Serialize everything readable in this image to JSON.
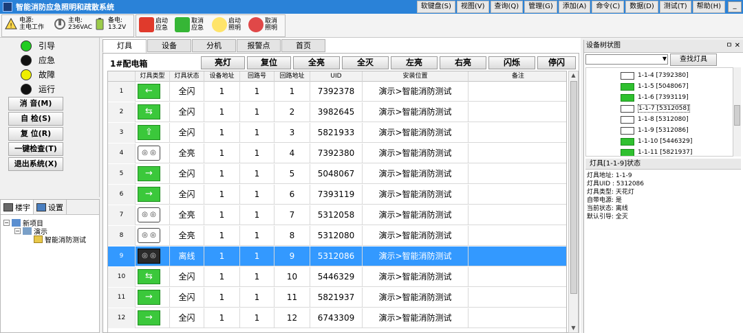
{
  "window": {
    "title": "智能消防应急照明和疏散系统",
    "min_label": "_"
  },
  "menu": [
    "软键盘(S)",
    "视图(V)",
    "查询(Q)",
    "管理(G)",
    "添加(A)",
    "命令(C)",
    "数据(D)",
    "测试(T)",
    "帮助(H)"
  ],
  "status": {
    "power": {
      "l1": "电源:",
      "l2": "主电工作"
    },
    "main_power": {
      "l1": "主电:",
      "l2": "236VAC"
    },
    "backup_power": {
      "l1": "备电:",
      "l2": "13.2V"
    }
  },
  "toolbar": {
    "start_emergency": {
      "l1": "启动",
      "l2": "应急"
    },
    "cancel_emergency": {
      "l1": "取消",
      "l2": "应急"
    },
    "start_lighting": {
      "l1": "启动",
      "l2": "照明"
    },
    "cancel_lighting": {
      "l1": "取消",
      "l2": "照明"
    }
  },
  "indicators": [
    {
      "label": "引导",
      "color": "#22cc22"
    },
    {
      "label": "应急",
      "color": "#111111"
    },
    {
      "label": "故障",
      "color": "#eeee00"
    },
    {
      "label": "运行",
      "color": "#111111"
    }
  ],
  "left_buttons": [
    "消  音(M)",
    "自  检(S)",
    "复  位(R)",
    "一键检查(T)",
    "退出系统(X)"
  ],
  "left_tabs": {
    "tree": "楼宇",
    "settings": "设置"
  },
  "project_tree": {
    "root": "新项目",
    "child": "演示",
    "leaf": "智能消防测试"
  },
  "tabs": [
    "灯具",
    "设备",
    "分机",
    "报警点",
    "首页"
  ],
  "cabinet": "1#配电箱",
  "commands": [
    "亮灯",
    "复位",
    "全亮",
    "全灭",
    "左亮",
    "右亮",
    "闪烁",
    "停闪"
  ],
  "grid": {
    "headers": [
      "灯具类型",
      "灯具状态",
      "设备地址",
      "回路号",
      "回路地址",
      "UID",
      "安装位置",
      "备注"
    ],
    "rows": [
      {
        "n": "1",
        "type": "green-left",
        "glyph": "←",
        "status": "全闪",
        "dev": "1",
        "loop": "1",
        "addr": "1",
        "uid": "7392378",
        "loc": "演示>智能消防测试",
        "note": ""
      },
      {
        "n": "2",
        "type": "green-both",
        "glyph": "⇆",
        "status": "全闪",
        "dev": "1",
        "loop": "1",
        "addr": "2",
        "uid": "3982645",
        "loc": "演示>智能消防测试",
        "note": ""
      },
      {
        "n": "3",
        "type": "green-exit",
        "glyph": "⇧",
        "status": "全闪",
        "dev": "1",
        "loop": "1",
        "addr": "3",
        "uid": "5821933",
        "loc": "演示>智能消防测试",
        "note": ""
      },
      {
        "n": "4",
        "type": "ceiling",
        "glyph": "◎ ◎",
        "status": "全亮",
        "dev": "1",
        "loop": "1",
        "addr": "4",
        "uid": "7392380",
        "loc": "演示>智能消防测试",
        "note": ""
      },
      {
        "n": "5",
        "type": "green-right",
        "glyph": "→",
        "status": "全闪",
        "dev": "1",
        "loop": "1",
        "addr": "5",
        "uid": "5048067",
        "loc": "演示>智能消防测试",
        "note": ""
      },
      {
        "n": "6",
        "type": "green-right",
        "glyph": "→",
        "status": "全闪",
        "dev": "1",
        "loop": "1",
        "addr": "6",
        "uid": "7393119",
        "loc": "演示>智能消防测试",
        "note": ""
      },
      {
        "n": "7",
        "type": "ceiling",
        "glyph": "◎ ◎",
        "status": "全亮",
        "dev": "1",
        "loop": "1",
        "addr": "7",
        "uid": "5312058",
        "loc": "演示>智能消防测试",
        "note": ""
      },
      {
        "n": "8",
        "type": "ceiling",
        "glyph": "◎ ◎",
        "status": "全亮",
        "dev": "1",
        "loop": "1",
        "addr": "8",
        "uid": "5312080",
        "loc": "演示>智能消防测试",
        "note": ""
      },
      {
        "n": "9",
        "type": "offline",
        "glyph": "◎ ◎",
        "status": "离线",
        "dev": "1",
        "loop": "1",
        "addr": "9",
        "uid": "5312086",
        "loc": "演示>智能消防测试",
        "note": "",
        "selected": true
      },
      {
        "n": "10",
        "type": "green-both",
        "glyph": "⇆",
        "status": "全闪",
        "dev": "1",
        "loop": "1",
        "addr": "10",
        "uid": "5446329",
        "loc": "演示>智能消防测试",
        "note": ""
      },
      {
        "n": "11",
        "type": "green-right",
        "glyph": "→",
        "status": "全闪",
        "dev": "1",
        "loop": "1",
        "addr": "11",
        "uid": "5821937",
        "loc": "演示>智能消防测试",
        "note": ""
      },
      {
        "n": "12",
        "type": "green-right",
        "glyph": "→",
        "status": "全闪",
        "dev": "1",
        "loop": "1",
        "addr": "12",
        "uid": "6743309",
        "loc": "演示>智能消防测试",
        "note": ""
      }
    ]
  },
  "device_tree": {
    "title": "设备树状图",
    "pins": "ㅁ ✕",
    "find_button": "查找灯具",
    "items": [
      {
        "label": "1-1-4 [7392380]",
        "kind": "white"
      },
      {
        "label": "1-1-5 [5048067]",
        "kind": "green"
      },
      {
        "label": "1-1-6 [7393119]",
        "kind": "green"
      },
      {
        "label": "1-1-7 [5312058]",
        "kind": "white",
        "hl": true
      },
      {
        "label": "1-1-8 [5312080]",
        "kind": "white"
      },
      {
        "label": "1-1-9 [5312086]",
        "kind": "white"
      },
      {
        "label": "1-1-10 [5446329]",
        "kind": "green"
      },
      {
        "label": "1-1-11 [5821937]",
        "kind": "green"
      }
    ]
  },
  "lamp_status": {
    "title": "灯具[1-1-9]状态",
    "lines": [
      "灯具地址: 1-1-9",
      "灯具UID : 5312086",
      "灯具类型: 天花灯",
      "自带电源: 是",
      "当前状态: 离线",
      "默认引导: 全灭"
    ]
  }
}
